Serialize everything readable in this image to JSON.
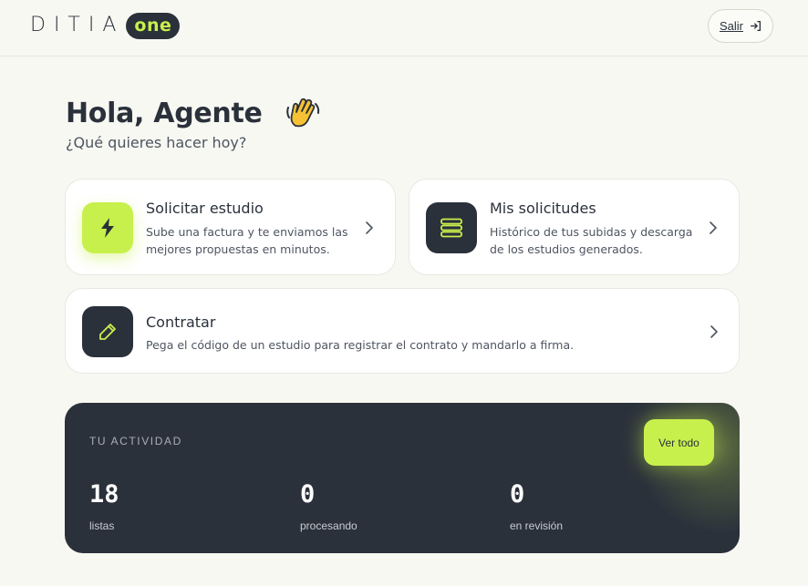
{
  "header": {
    "logo_word": "DITIA",
    "logo_pill": "one",
    "logout_label": "Salir"
  },
  "greeting": {
    "title": "Hola, Agente",
    "emoji": "waving-hand",
    "subtitle": "¿Qué quieres hacer hoy?"
  },
  "cards": [
    {
      "title": "Solicitar estudio",
      "description": "Sube una factura y te enviamos las mejores propuestas en minutos.",
      "icon": "lightning-icon",
      "tile_color": "#c8f04c"
    },
    {
      "title": "Mis solicitudes",
      "description": "Histórico de tus subidas y descarga de los estudios generados.",
      "icon": "stack-icon",
      "tile_color": "#2b313b"
    },
    {
      "title": "Contratar",
      "description": "Pega el código de un estudio para registrar el contrato y mandarlo a firma.",
      "icon": "pencil-icon",
      "tile_color": "#2b313b"
    }
  ],
  "activity": {
    "title": "TU ACTIVIDAD",
    "view_all_label": "Ver todo",
    "stats": [
      {
        "value": "18",
        "label": "listas"
      },
      {
        "value": "0",
        "label": "procesando"
      },
      {
        "value": "0",
        "label": "en revisión"
      }
    ]
  },
  "colors": {
    "accent": "#c8f04c",
    "dark": "#2b313b",
    "background": "#f8f8f3"
  }
}
